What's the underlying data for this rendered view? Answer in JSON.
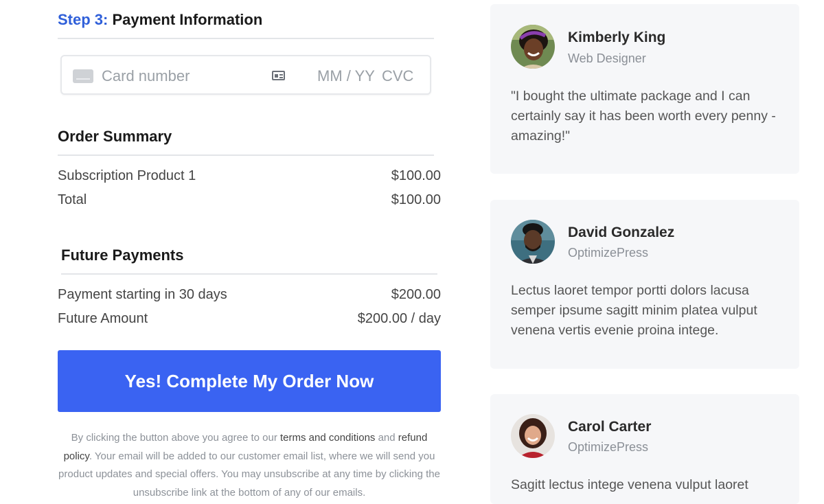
{
  "payment": {
    "step_label": "Step 3:",
    "title": "Payment Information",
    "card_placeholder": "Card number",
    "expiry_placeholder": "MM / YY",
    "cvc_placeholder": "CVC"
  },
  "order_summary": {
    "title": "Order Summary",
    "rows": [
      {
        "label": "Subscription Product 1",
        "value": "$100.00"
      },
      {
        "label": "Total",
        "value": "$100.00"
      }
    ]
  },
  "future_payments": {
    "title": "Future Payments",
    "rows": [
      {
        "label": "Payment starting in 30 days",
        "value": "$200.00"
      },
      {
        "label": "Future Amount",
        "value": "$200.00 / day"
      }
    ]
  },
  "cta": {
    "label": "Yes! Complete My Order Now",
    "color": "#3a63f2"
  },
  "legal": {
    "text1": "By clicking the button above you agree to our ",
    "terms_link": "terms and conditions",
    "text2": " and ",
    "refund_link": "refund policy",
    "text3": ".  Your email will be added to our customer email list, where we will send you product updates and special offers. You may unsubscribe at any time by clicking the unsubscribe link at the bottom of any of our emails."
  },
  "testimonials": [
    {
      "name": "Kimberly King",
      "role": "Web Designer",
      "quote": "\"I bought the ultimate package and I can certainly say it has been worth every penny - amazing!\""
    },
    {
      "name": "David Gonzalez",
      "role": "OptimizePress",
      "quote": "Lectus laoret tempor portti dolors lacusa semper ipsume sagitt minim platea vulput venena vertis evenie proina intege."
    },
    {
      "name": "Carol Carter",
      "role": "OptimizePress",
      "quote": "Sagitt lectus intege venena vulput laoret"
    }
  ],
  "icons": {
    "card": "credit-card-icon",
    "id_card": "id-card-icon"
  }
}
